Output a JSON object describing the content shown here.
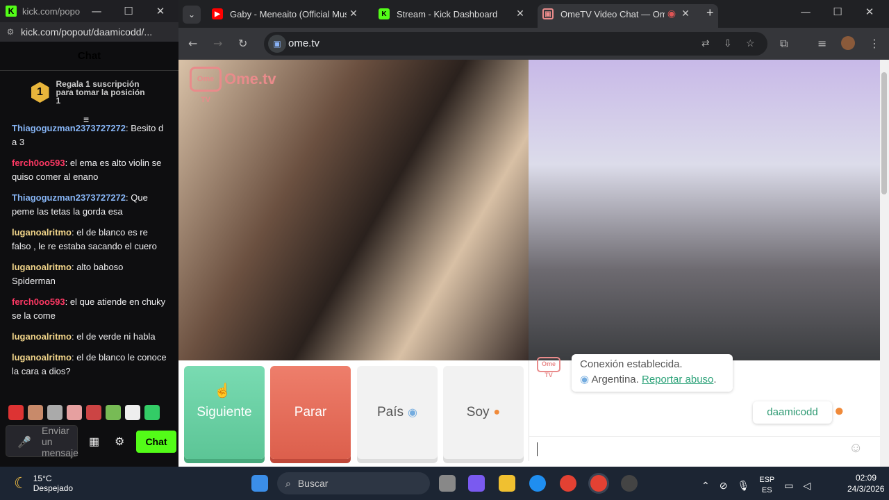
{
  "popout": {
    "title": "kick.com/popo...",
    "url": "kick.com/popout/daamicodd/...",
    "chat_heading": "Chat",
    "promo_rank": "1",
    "promo_text": "Regala 1 suscripción para tomar la posición 1",
    "messages": [
      {
        "user": "Thiagoguzman2373727272",
        "color": "#86b4f4",
        "text": "Besito d a 3"
      },
      {
        "user": "ferch0oo593",
        "color": "#ff3864",
        "text": "el ema es alto violin se quiso comer al enano"
      },
      {
        "user": "Thiagoguzman2373727272",
        "color": "#86b4f4",
        "text": "Que peme las tetas la gorda esa"
      },
      {
        "user": "luganoalritmo",
        "color": "#f2d58a",
        "text": "el de blanco es re falso , le re estaba sacando el cuero"
      },
      {
        "user": "luganoalritmo",
        "color": "#f2d58a",
        "text": "alto baboso Spiderman"
      },
      {
        "user": "ferch0oo593",
        "color": "#ff3864",
        "text": "el que atiende en chuky se la come"
      },
      {
        "user": "luganoalritmo",
        "color": "#f2d58a",
        "text": "el de verde ni habla"
      },
      {
        "user": "luganoalritmo",
        "color": "#f2d58a",
        "text": "el de blanco le conoce la cara a dios?"
      }
    ],
    "input_placeholder": "Enviar un mensaje",
    "chat_button": "Chat"
  },
  "browser": {
    "tabs": [
      {
        "title": "Gaby - Meneaito (Official Music",
        "icon": "youtube-icon",
        "color": "#ff0000"
      },
      {
        "title": "Stream - Kick Dashboard",
        "icon": "kick-icon",
        "color": "#53fc18"
      },
      {
        "title": "OmeTV Video Chat — Ome",
        "icon": "ometv-icon",
        "color": "#e98b8b"
      }
    ],
    "url": "ome.tv"
  },
  "ometv": {
    "logo_text": "Ome.tv",
    "logo_badge": "Ome TV",
    "buttons": {
      "next": "Siguiente",
      "stop": "Parar",
      "country": "País",
      "me": "Soy"
    },
    "system_message": "Conexión establecida.",
    "country_line": "Argentina.",
    "report_link": "Reportar abuso",
    "user_message": "daamicodd"
  },
  "taskbar": {
    "temp": "15°C",
    "weather": "Despejado",
    "search": "Buscar",
    "lang1": "ESP",
    "lang2": "ES",
    "time": "02:09",
    "date": "24/3/2026"
  }
}
